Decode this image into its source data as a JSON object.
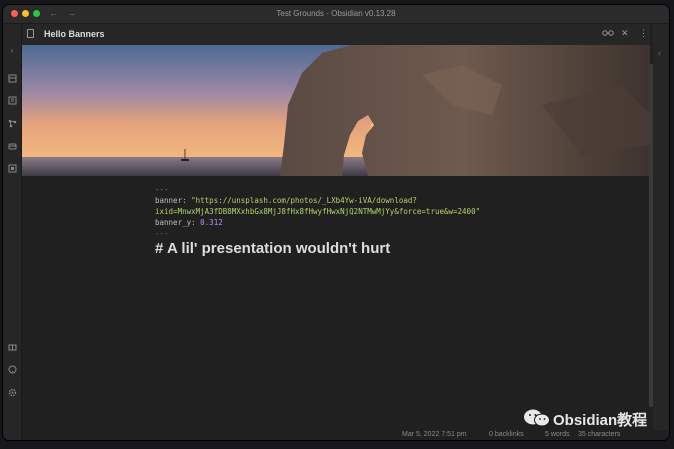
{
  "window": {
    "title": "Test Grounds - Obsidian v0.13.28",
    "back_arrow": "←",
    "forward_arrow": "→"
  },
  "ribbon": {
    "icons": [
      "collapse-icon",
      "files-icon",
      "search-icon",
      "graph-icon",
      "templates-icon",
      "calendar-icon",
      "vault-icon",
      "help-icon",
      "settings-icon"
    ]
  },
  "pane": {
    "title": "Hello Banners",
    "actions": [
      "reading-mode-icon",
      "close-icon",
      "more-options-icon"
    ]
  },
  "editor": {
    "frontmatter_open": "---",
    "banner_key": "banner:",
    "banner_value_line1": "\"https://unsplash.com/photos/_LXb4Yw-iVA/download?",
    "banner_value_line2": "ixid=MnwxMjA3fDB8MXxhbGx8MjJ8fHx8fHwyfHwxNjQ2NTMwMjYy&force=true&w=2400\"",
    "banner_y_key": "banner_y:",
    "banner_y_value": "0.312",
    "frontmatter_close": "---",
    "heading": "# A lil' presentation wouldn't hurt"
  },
  "status": {
    "modified": "Mar 5, 2022 7:51 pm",
    "backlinks": "0 backlinks",
    "words": "5 words",
    "characters": "35 characters"
  },
  "watermark": {
    "text": "Obsidian教程"
  },
  "colors": {
    "background": "#202020",
    "frontmatter_delimiter": "#6a9955",
    "string": "#b5d36a",
    "number": "#b392f0"
  }
}
